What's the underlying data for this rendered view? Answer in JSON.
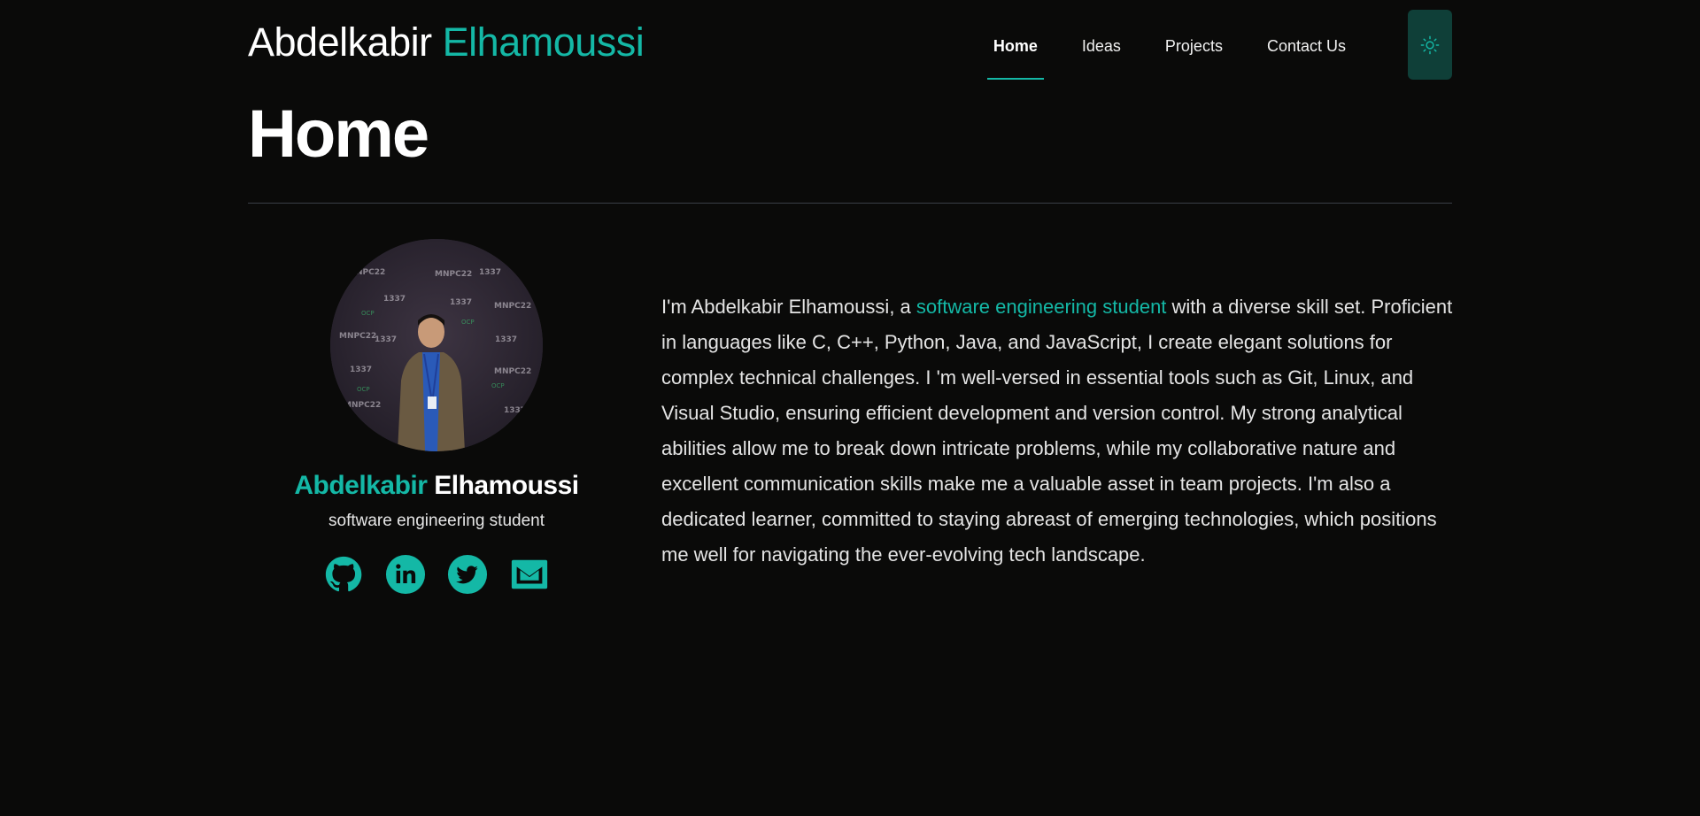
{
  "header": {
    "brand_first": "Abdelkabir",
    "brand_last": "Elhamoussi",
    "nav": [
      {
        "label": "Home",
        "active": true
      },
      {
        "label": "Ideas"
      },
      {
        "label": "Projects"
      },
      {
        "label": "Contact Us"
      }
    ],
    "theme_toggle_icon": "sun-icon"
  },
  "page": {
    "title": "Home"
  },
  "profile": {
    "first_name": "Abdelkabir",
    "last_name": "Elhamoussi",
    "role": "software engineering student",
    "socials": [
      {
        "name": "github",
        "icon": "github-icon"
      },
      {
        "name": "linkedin",
        "icon": "linkedin-icon"
      },
      {
        "name": "twitter",
        "icon": "twitter-icon"
      },
      {
        "name": "email",
        "icon": "mail-icon"
      }
    ]
  },
  "bio": {
    "before": "I'm Abdelkabir Elhamoussi, a ",
    "highlight": "software engineering student",
    "after": " with a diverse skill set. Proficient in languages like C, C++, Python, Java, and JavaScript, I create elegant solutions for complex technical challenges. I 'm well-versed in essential tools such as Git, Linux, and Visual Studio, ensuring efficient development and version control. My strong analytical abilities allow me to break down intricate problems, while my collaborative nature and excellent communication skills make me a valuable asset in team projects. I'm also a dedicated learner, committed to staying abreast of emerging technologies, which positions me well for navigating the ever-evolving tech landscape."
  },
  "colors": {
    "background": "#0a0a09",
    "accent": "#14b8a6",
    "theme_button": "#0f3f38",
    "divider": "#3a3f47"
  }
}
